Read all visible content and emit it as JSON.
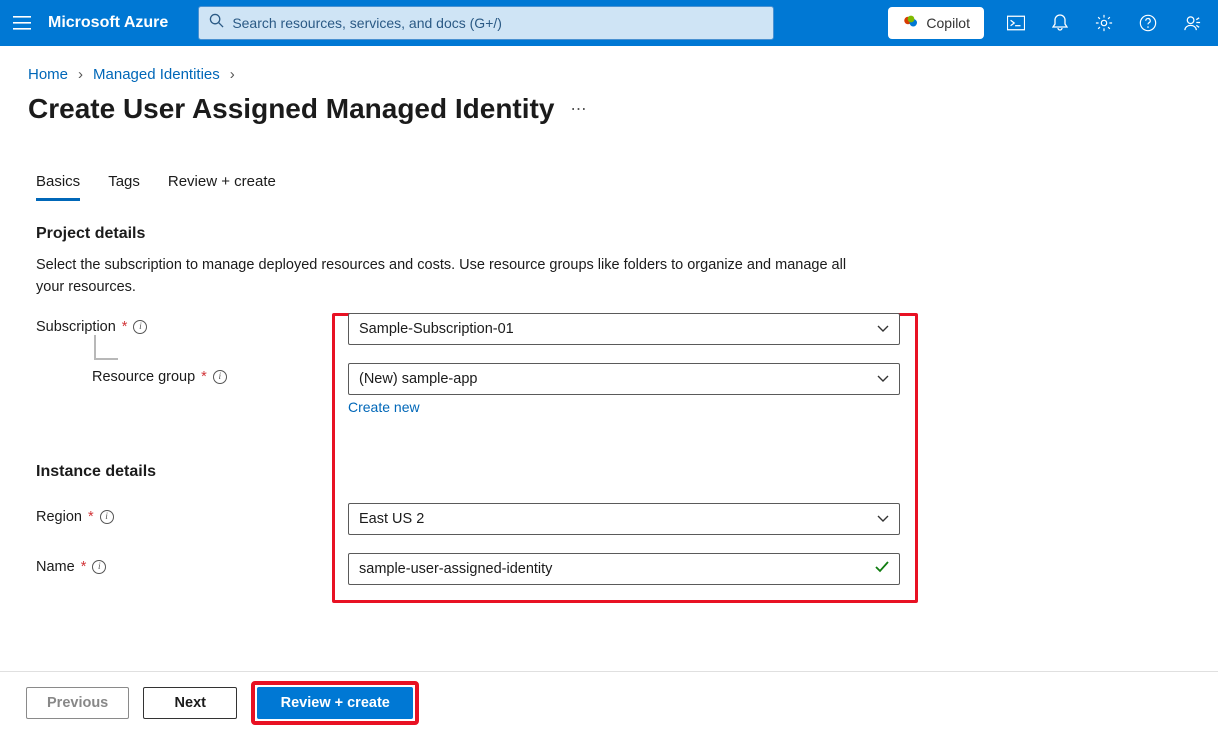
{
  "header": {
    "brand": "Microsoft Azure",
    "search_placeholder": "Search resources, services, and docs (G+/)",
    "copilot_label": "Copilot"
  },
  "breadcrumb": {
    "items": [
      "Home",
      "Managed Identities"
    ]
  },
  "page": {
    "title": "Create User Assigned Managed Identity"
  },
  "tabs": {
    "items": [
      "Basics",
      "Tags",
      "Review + create"
    ],
    "active_index": 0
  },
  "sections": {
    "project": {
      "heading": "Project details",
      "description": "Select the subscription to manage deployed resources and costs. Use resource groups like folders to organize and manage all your resources.",
      "subscription_label": "Subscription",
      "subscription_value": "Sample-Subscription-01",
      "resource_group_label": "Resource group",
      "resource_group_value": "(New) sample-app",
      "create_new_link": "Create new"
    },
    "instance": {
      "heading": "Instance details",
      "region_label": "Region",
      "region_value": "East US 2",
      "name_label": "Name",
      "name_value": "sample-user-assigned-identity"
    }
  },
  "footer": {
    "previous": "Previous",
    "next": "Next",
    "review_create": "Review + create"
  }
}
